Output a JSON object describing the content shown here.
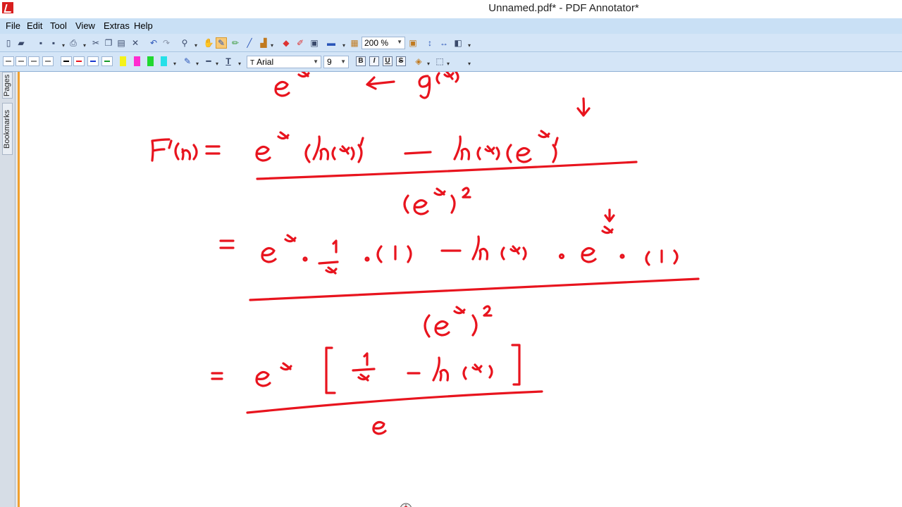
{
  "window": {
    "title": "Unnamed.pdf* - PDF Annotator*"
  },
  "menu": {
    "items": [
      "File",
      "Edit",
      "Tool",
      "View",
      "Extras",
      "Help"
    ]
  },
  "toolbar": {
    "zoom": "200 %"
  },
  "format_bar": {
    "font": "Arial",
    "size": "9",
    "bold": "B",
    "italic": "I",
    "underline": "U",
    "strike": "S",
    "text_tool": "T"
  },
  "side_panel": {
    "tabs": [
      "Pages",
      "Bookmarks"
    ]
  },
  "colors": {
    "ink": "#e8141e",
    "accent": "#f0a030"
  }
}
